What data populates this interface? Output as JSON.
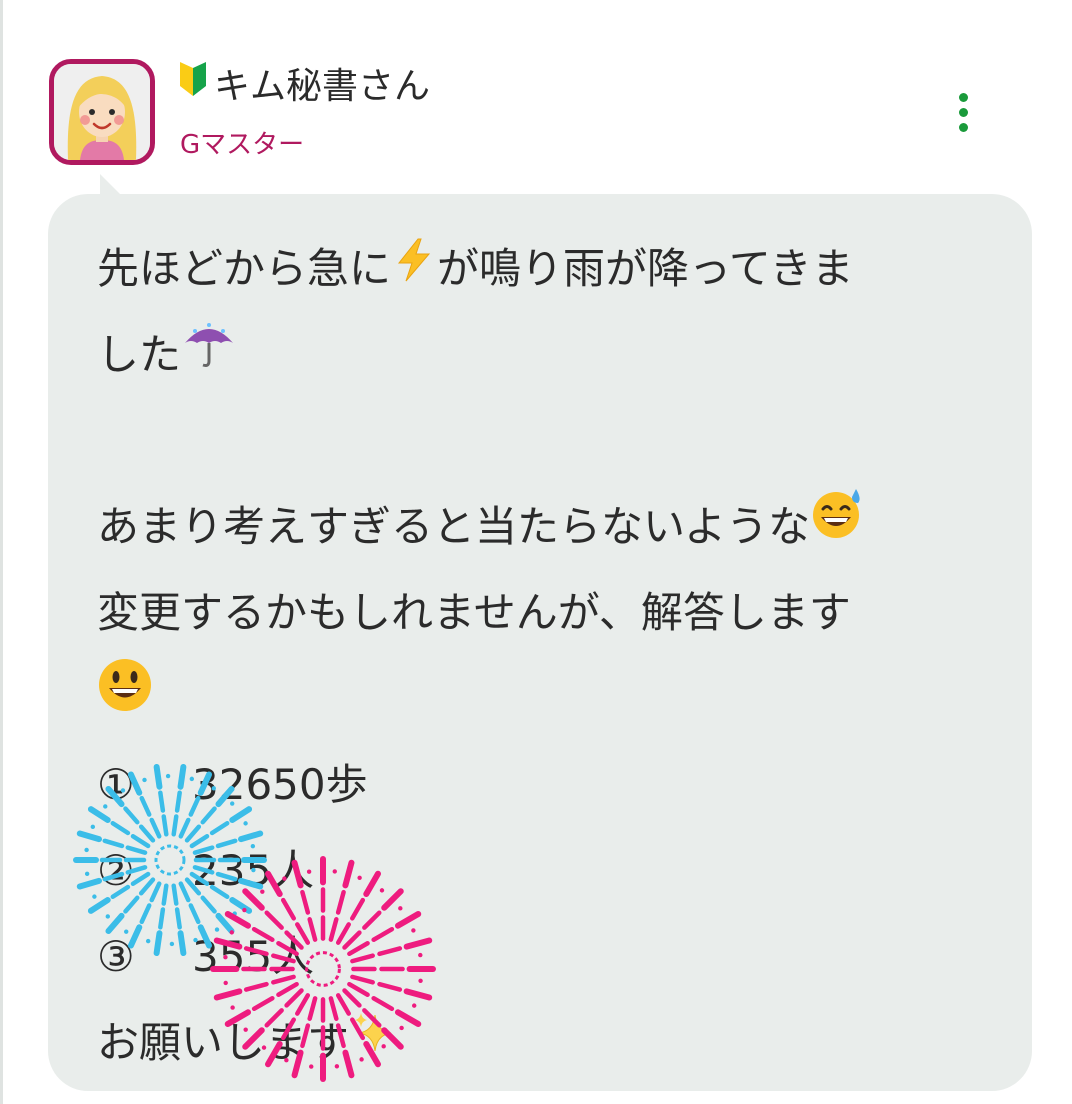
{
  "post": {
    "user_name": "キム秘書さん",
    "user_rank": "Gマスター",
    "beginner_mark_icon": "beginner-mark-icon",
    "menu_icon": "more-vertical-icon"
  },
  "message": {
    "line1": "先ほどから急に",
    "line1_after": "が鳴り雨が降ってきま",
    "line2": "した",
    "line4": "あまり考えすぎると当たらないような",
    "line5": "変更するかもしれませんが、解答します",
    "answers": [
      {
        "marker": "①",
        "value": "32650歩"
      },
      {
        "marker": "②",
        "value": "235人"
      },
      {
        "marker": "③",
        "value": "355人"
      }
    ],
    "closing": "お願いします"
  },
  "emojis": [
    "lightning-icon",
    "umbrella-rain-icon",
    "sweat-smile-icon",
    "smiley-icon",
    "sparkles-icon"
  ],
  "stamps": [
    "firework-blue-stamp",
    "firework-pink-stamp"
  ],
  "colors": {
    "accent": "#b0195f",
    "menu_dots": "#1a9a3b",
    "bubble_bg": "#e9edeb",
    "firework_blue": "#3bbde8",
    "firework_pink": "#ee1c7f"
  }
}
